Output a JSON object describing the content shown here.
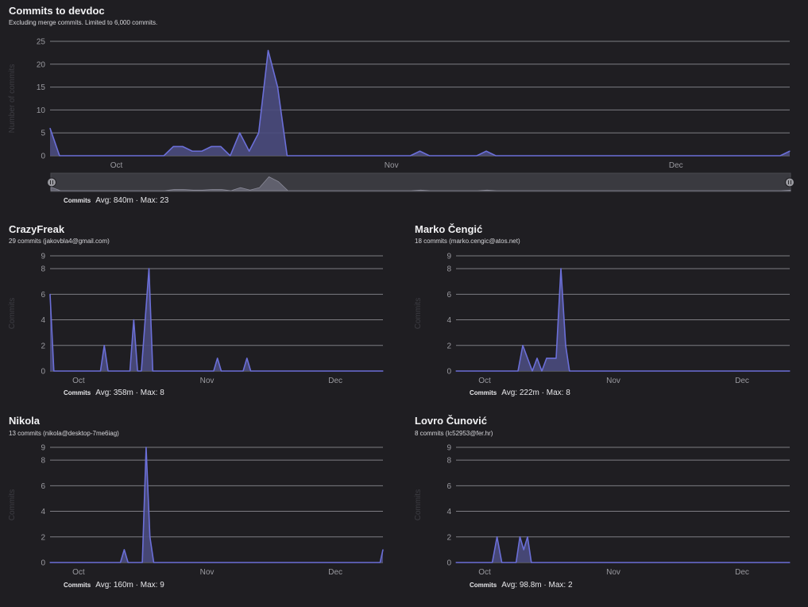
{
  "colors": {
    "line": "#6b6fd8",
    "fill": "#4a4b7e",
    "grid": "#7d7d83",
    "text": "#9a9aa0",
    "ylabel": "#3d3d43"
  },
  "main": {
    "title": "Commits to devdoc",
    "subtitle": "Excluding merge commits. Limited to 6,000 commits.",
    "legend_series": "Commits",
    "legend_stats": "Avg: 840m · Max: 23"
  },
  "contributors": [
    {
      "name": "CrazyFreak",
      "meta": "29 commits (jakovbla4@gmail.com)",
      "legend_series": "Commits",
      "legend_stats": "Avg: 358m · Max: 8"
    },
    {
      "name": "Marko Čengić",
      "meta": "18 commits (marko.cengic@atos.net)",
      "legend_series": "Commits",
      "legend_stats": "Avg: 222m · Max: 8"
    },
    {
      "name": "Nikola",
      "meta": "13 commits (nikola@desktop-7me6iag)",
      "legend_series": "Commits",
      "legend_stats": "Avg: 160m · Max: 9"
    },
    {
      "name": "Lovro Čunović",
      "meta": "8 commits (lc52953@fer.hr)",
      "legend_series": "Commits",
      "legend_stats": "Avg: 98.8m · Max: 2"
    }
  ],
  "chart_data": [
    {
      "type": "area",
      "ylabel": "Number of commits",
      "ylim": [
        0,
        25
      ],
      "yticks": [
        0,
        5,
        10,
        15,
        20,
        25
      ],
      "x_month_labels": [
        "Oct",
        "Nov",
        "Dec"
      ],
      "x_month_positions": [
        7,
        36,
        66
      ],
      "x_count": 78,
      "points": [
        [
          0,
          6
        ],
        [
          1,
          0
        ],
        [
          12,
          0
        ],
        [
          13,
          2
        ],
        [
          14,
          2
        ],
        [
          15,
          1
        ],
        [
          16,
          1
        ],
        [
          17,
          2
        ],
        [
          18,
          2
        ],
        [
          19,
          0
        ],
        [
          20,
          5
        ],
        [
          21,
          1
        ],
        [
          22,
          5
        ],
        [
          23,
          23
        ],
        [
          24,
          15
        ],
        [
          25,
          0
        ],
        [
          38,
          0
        ],
        [
          39,
          1
        ],
        [
          40,
          0
        ],
        [
          45,
          0
        ],
        [
          46,
          1
        ],
        [
          47,
          0
        ],
        [
          77,
          0
        ],
        [
          78,
          1
        ]
      ],
      "grid": true
    },
    {
      "type": "area",
      "ylabel": "Commits",
      "ylim": [
        0,
        9
      ],
      "yticks": [
        0,
        2,
        4,
        6,
        8,
        9
      ],
      "x_month_labels": [
        "Oct",
        "Nov",
        "Dec"
      ],
      "x_month_positions": [
        3,
        16.5,
        30
      ],
      "x_count": 35,
      "points": [
        [
          0,
          6
        ],
        [
          0.4,
          0
        ],
        [
          5.3,
          0
        ],
        [
          5.7,
          2
        ],
        [
          6.1,
          0
        ],
        [
          8.4,
          0
        ],
        [
          8.8,
          4
        ],
        [
          9.2,
          0
        ],
        [
          9.6,
          0
        ],
        [
          10.4,
          8
        ],
        [
          10.8,
          0
        ],
        [
          17.2,
          0
        ],
        [
          17.6,
          1
        ],
        [
          18,
          0
        ],
        [
          20.3,
          0
        ],
        [
          20.7,
          1
        ],
        [
          21.1,
          0
        ],
        [
          35,
          0
        ]
      ],
      "grid": true
    },
    {
      "type": "area",
      "ylabel": "Commits",
      "ylim": [
        0,
        9
      ],
      "yticks": [
        0,
        2,
        4,
        6,
        8,
        9
      ],
      "x_month_labels": [
        "Oct",
        "Nov",
        "Dec"
      ],
      "x_month_positions": [
        3,
        16.5,
        30
      ],
      "x_count": 35,
      "points": [
        [
          0,
          0
        ],
        [
          6.5,
          0
        ],
        [
          7.0,
          2
        ],
        [
          7.5,
          1
        ],
        [
          8.0,
          0
        ],
        [
          8.5,
          1
        ],
        [
          9.0,
          0
        ],
        [
          9.5,
          1
        ],
        [
          10.5,
          1
        ],
        [
          11.0,
          8
        ],
        [
          11.5,
          2
        ],
        [
          11.9,
          0
        ],
        [
          35,
          0
        ]
      ],
      "grid": true
    },
    {
      "type": "area",
      "ylabel": "Commits",
      "ylim": [
        0,
        9
      ],
      "yticks": [
        0,
        2,
        4,
        6,
        8,
        9
      ],
      "x_month_labels": [
        "Oct",
        "Nov",
        "Dec"
      ],
      "x_month_positions": [
        3,
        16.5,
        30
      ],
      "x_count": 35,
      "points": [
        [
          0,
          0
        ],
        [
          7.4,
          0
        ],
        [
          7.8,
          1
        ],
        [
          8.2,
          0
        ],
        [
          9.7,
          0
        ],
        [
          10.1,
          9
        ],
        [
          10.5,
          2
        ],
        [
          10.9,
          0
        ],
        [
          34.7,
          0
        ],
        [
          35,
          1
        ]
      ],
      "grid": true
    },
    {
      "type": "area",
      "ylabel": "Commits",
      "ylim": [
        0,
        9
      ],
      "yticks": [
        0,
        2,
        4,
        6,
        8,
        9
      ],
      "x_month_labels": [
        "Oct",
        "Nov",
        "Dec"
      ],
      "x_month_positions": [
        3,
        16.5,
        30
      ],
      "x_count": 35,
      "points": [
        [
          0,
          0
        ],
        [
          3.8,
          0
        ],
        [
          4.3,
          2
        ],
        [
          4.8,
          0
        ],
        [
          6.3,
          0
        ],
        [
          6.7,
          2
        ],
        [
          7.1,
          1
        ],
        [
          7.5,
          2
        ],
        [
          7.9,
          0
        ],
        [
          35,
          0
        ]
      ],
      "grid": true
    }
  ]
}
